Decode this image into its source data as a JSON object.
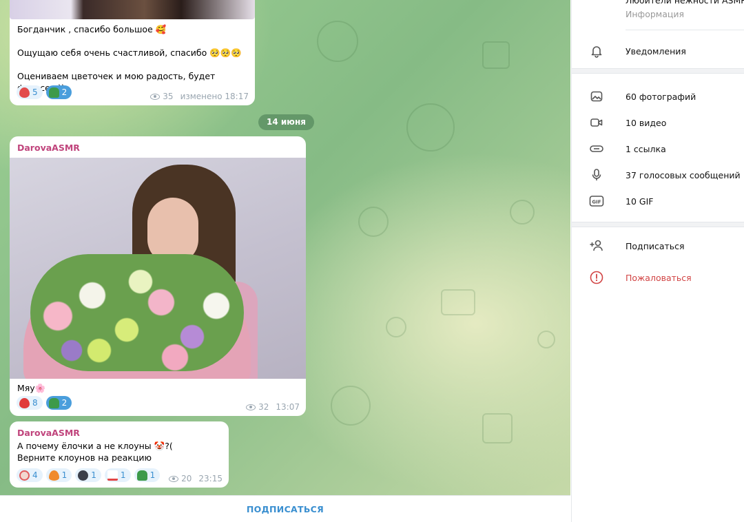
{
  "messages": [
    {
      "text": "Богданчик , спасибо большое 🥰\n\nОщущаю себя очень счастливой, спасибо 🥺🥺🥺\n\nОцениваем цветочек и мою радость, будет фотосет ))",
      "reactions": [
        {
          "emoji": "❤‍🔥",
          "count": "5",
          "active": false
        },
        {
          "emoji": "🎄",
          "count": "2",
          "active": true
        }
      ],
      "views": "35",
      "time": "изменено 18:17"
    },
    {
      "author": "DarovaASMR",
      "photo_alt": "girl-with-flower-bouquet-photo",
      "text": "Мяу🌸",
      "reactions": [
        {
          "emoji": "❤️",
          "count": "8",
          "active": false
        },
        {
          "emoji": "🎄",
          "count": "2",
          "active": true
        }
      ],
      "views": "32",
      "time": "13:07"
    },
    {
      "author": "DarovaASMR",
      "text": "А почему ёлочки а не клоуны 🤡?(\nВерните клоунов на реакцию",
      "reactions": [
        {
          "emoji": "🤡",
          "count": "4",
          "active": false
        },
        {
          "emoji": "🔥",
          "count": "1",
          "active": false
        },
        {
          "emoji": "🌚",
          "count": "1",
          "active": false
        },
        {
          "emoji": "💯",
          "count": "1",
          "active": false
        },
        {
          "emoji": "🎄",
          "count": "1",
          "active": false
        }
      ],
      "views": "20",
      "time": "23:15"
    }
  ],
  "date_separator": "14 июня",
  "subscribe_bar": {
    "label": "ПОДПИСАТЬСЯ"
  },
  "panel": {
    "channel_name": "Любители нежности ASMR",
    "channel_info": "Информация",
    "notifications": "Уведомления",
    "media": {
      "photos": "60 фотографий",
      "videos": "10 видео",
      "links": "1 ссылка",
      "voice": "37 голосовых сообщений",
      "gif": "10 GIF"
    },
    "subscribe": "Подписаться",
    "report": "Пожаловаться"
  },
  "colors": {
    "accent": "#3a8fd0",
    "author": "#c0447c",
    "danger": "#d14343",
    "active_reaction": "#4a9edc"
  }
}
